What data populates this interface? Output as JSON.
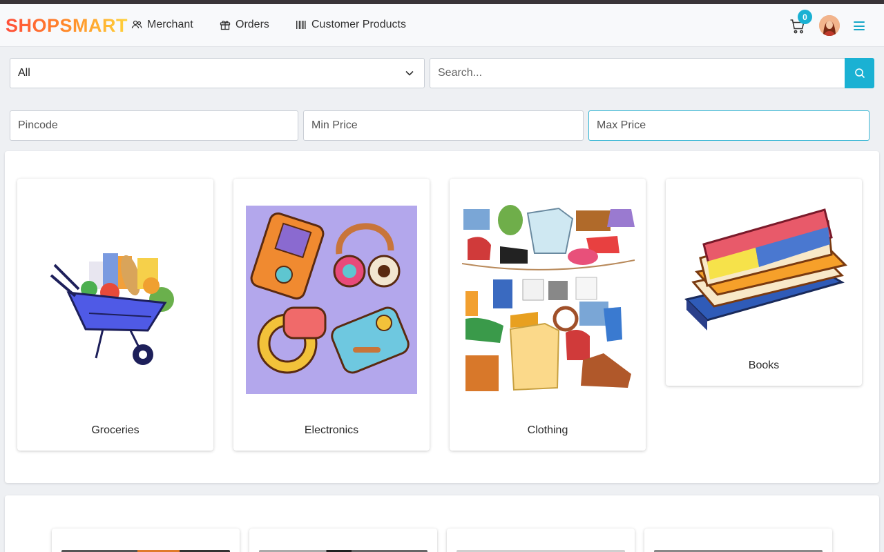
{
  "brand": "SHOPSMART",
  "nav": {
    "merchant": "Merchant",
    "orders": "Orders",
    "customer_products": "Customer Products"
  },
  "cart": {
    "count": "0"
  },
  "filters": {
    "category_selected": "All",
    "search_placeholder": "Search...",
    "pincode_placeholder": "Pincode",
    "min_price_placeholder": "Min Price",
    "max_price_placeholder": "Max Price"
  },
  "categories": [
    {
      "label": "Groceries",
      "icon": "wheelbarrow-groceries-image"
    },
    {
      "label": "Electronics",
      "icon": "gadgets-image"
    },
    {
      "label": "Clothing",
      "icon": "clothes-image"
    },
    {
      "label": "Books",
      "icon": "books-stack-image"
    }
  ],
  "colors": {
    "accent": "#1ab1d3",
    "brand_gradient": [
      "#ff4e3a",
      "#ff8a2a",
      "#ffd23a"
    ]
  }
}
